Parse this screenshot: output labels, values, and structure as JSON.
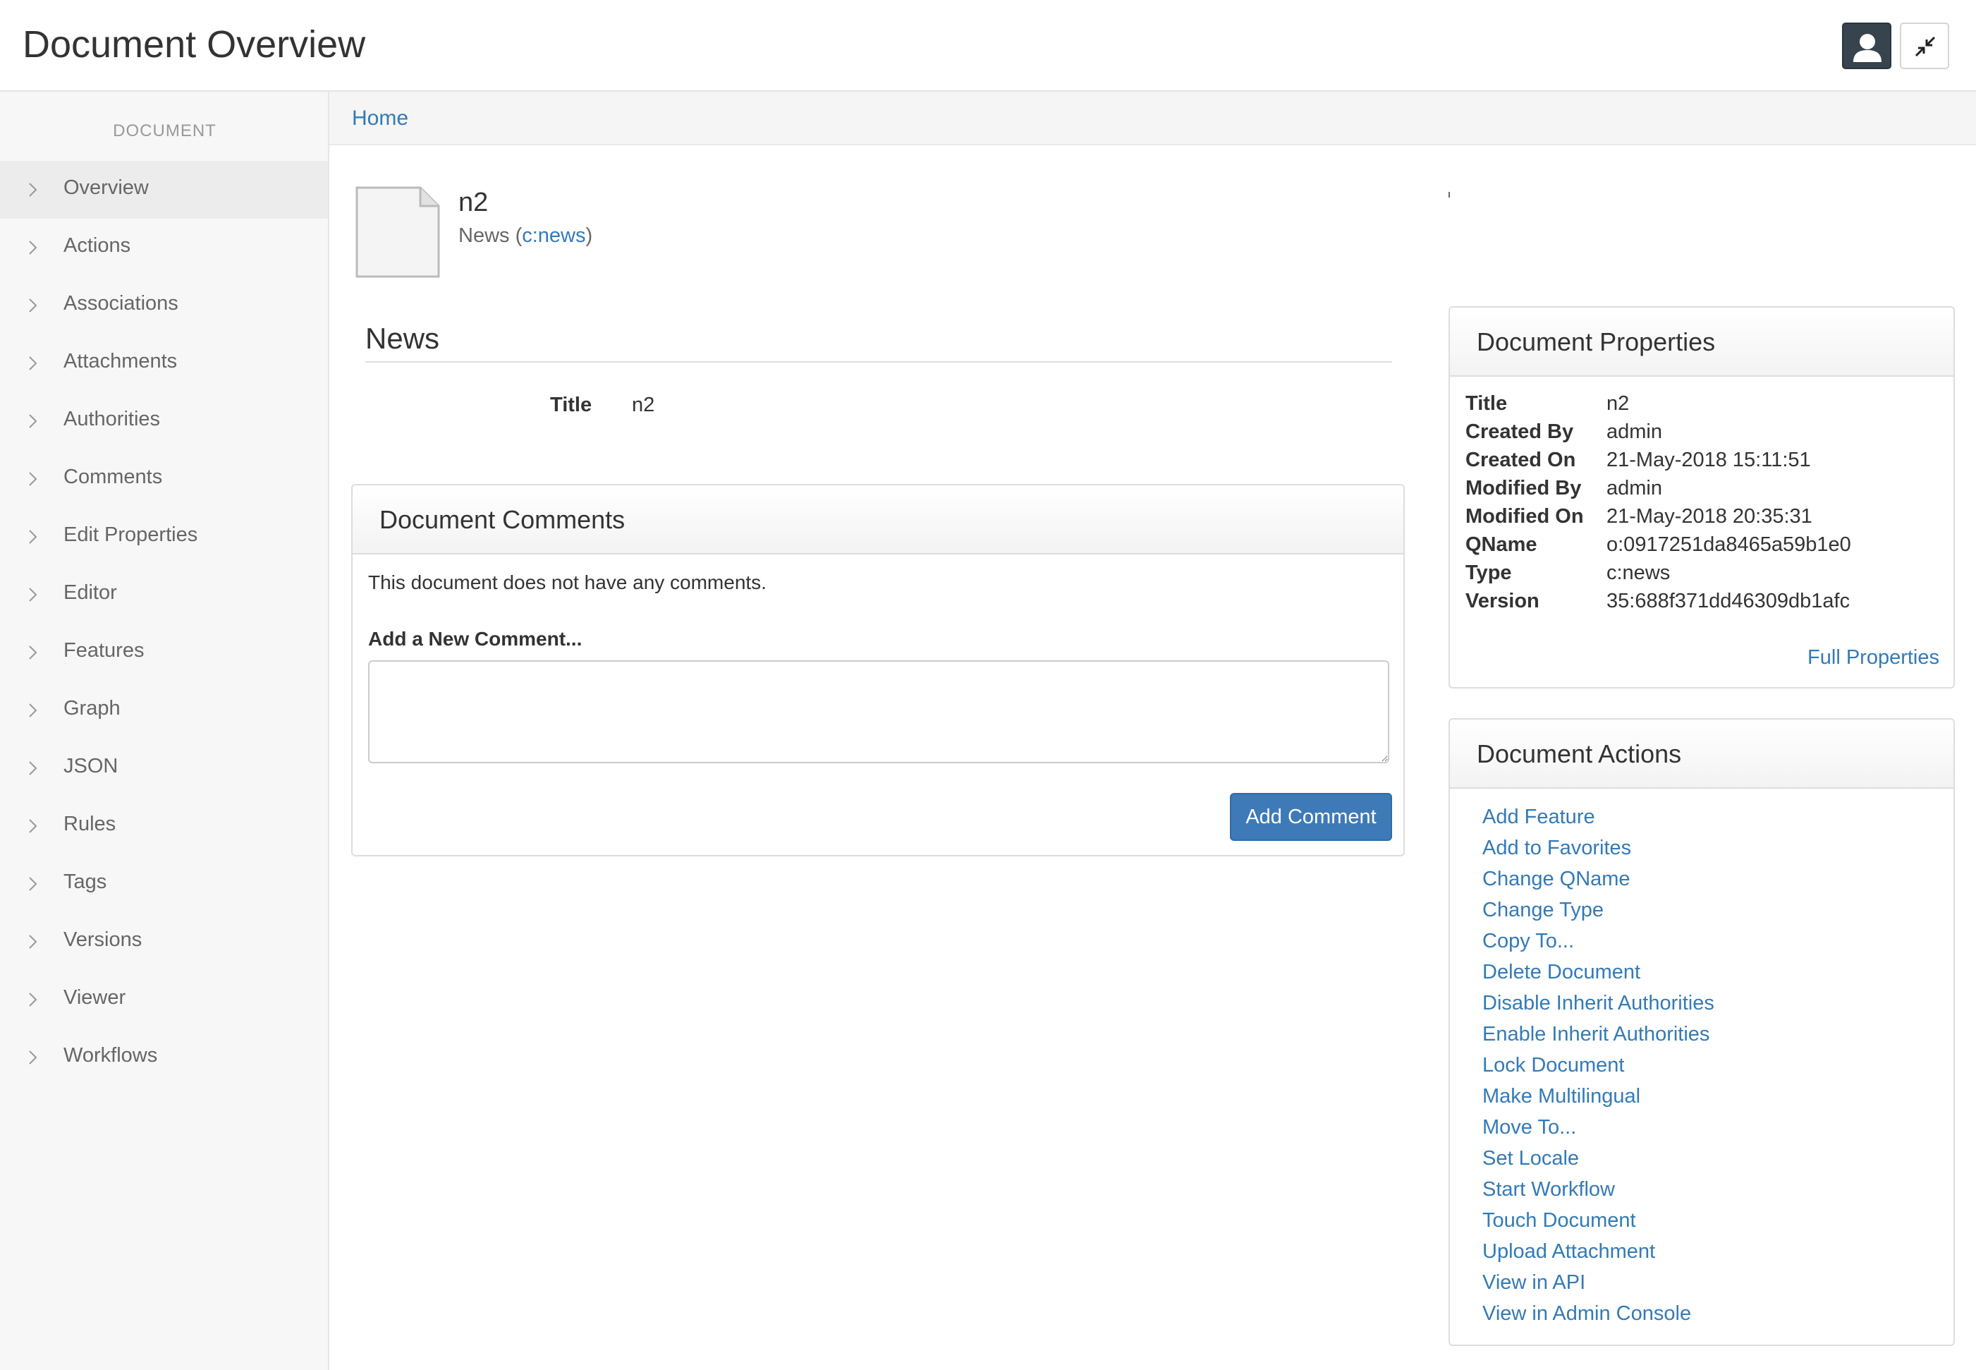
{
  "header": {
    "title": "Document Overview"
  },
  "sidebar": {
    "heading": "DOCUMENT",
    "items": [
      {
        "label": "Overview"
      },
      {
        "label": "Actions"
      },
      {
        "label": "Associations"
      },
      {
        "label": "Attachments"
      },
      {
        "label": "Authorities"
      },
      {
        "label": "Comments"
      },
      {
        "label": "Edit Properties"
      },
      {
        "label": "Editor"
      },
      {
        "label": "Features"
      },
      {
        "label": "Graph"
      },
      {
        "label": "JSON"
      },
      {
        "label": "Rules"
      },
      {
        "label": "Tags"
      },
      {
        "label": "Versions"
      },
      {
        "label": "Viewer"
      },
      {
        "label": "Workflows"
      }
    ]
  },
  "breadcrumb": {
    "home": "Home"
  },
  "document": {
    "name": "n2",
    "type_label": "News",
    "type_prefix": " (",
    "type_link": "c:news",
    "type_suffix": ")"
  },
  "aspect": {
    "title": "News",
    "field_label": "Title",
    "field_value": "n2"
  },
  "comments": {
    "title": "Document Comments",
    "empty_text": "This document does not have any comments.",
    "add_label": "Add a New Comment...",
    "textarea_value": "",
    "button_label": "Add Comment"
  },
  "properties": {
    "title": "Document Properties",
    "rows": [
      {
        "key": "Title",
        "value": "n2",
        "link": false
      },
      {
        "key": "Created By",
        "value": "admin",
        "link": true
      },
      {
        "key": "Created On",
        "value": "21-May-2018 15:11:51",
        "link": false
      },
      {
        "key": "Modified By",
        "value": "admin",
        "link": true
      },
      {
        "key": "Modified On",
        "value": "21-May-2018 20:35:31",
        "link": false
      },
      {
        "key": "QName",
        "value": "o:0917251da8465a59b1e0",
        "link": false
      },
      {
        "key": "Type",
        "value": "c:news",
        "link": true
      },
      {
        "key": "Version",
        "value": "35:688f371dd46309db1afc",
        "link": true
      }
    ],
    "full_link": "Full Properties"
  },
  "actions": {
    "title": "Document Actions",
    "items": [
      "Add Feature",
      "Add to Favorites",
      "Change QName",
      "Change Type",
      "Copy To...",
      "Delete Document",
      "Disable Inherit Authorities",
      "Enable Inherit Authorities",
      "Lock Document",
      "Make Multilingual",
      "Move To...",
      "Set Locale",
      "Start Workflow",
      "Touch Document",
      "Upload Attachment",
      "View in API",
      "View in Admin Console"
    ]
  },
  "colors": {
    "link": "#337ab7",
    "primary_button": "#3e7ab7",
    "sidebar_bg": "#f7f7f7",
    "header_button_dark": "#37444e"
  },
  "icons": {
    "avatar": "user-avatar-icon",
    "collapse": "compress-icon",
    "nav": "chevron-right-icon",
    "document": "document-icon"
  }
}
